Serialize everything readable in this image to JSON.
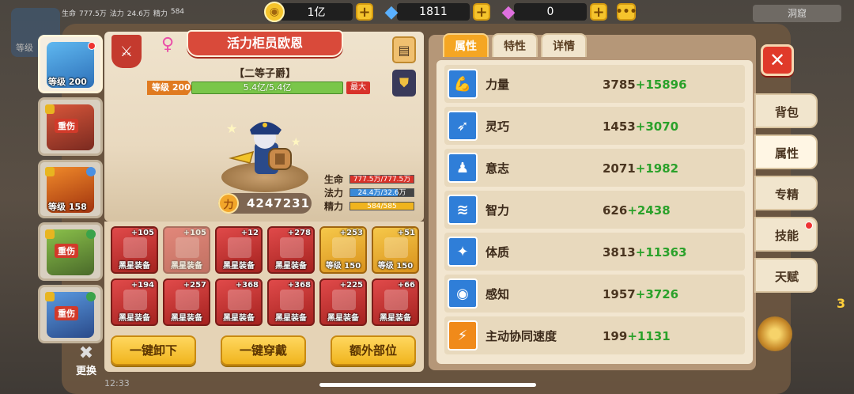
{
  "top": {
    "mini_stats": {
      "hp_label": "生命",
      "hp_value": "777.5万",
      "mp_label": "法力",
      "mp_value": "24.6万",
      "energy_label": "精力",
      "energy_value": "584"
    },
    "mini_avatar_level": "等级",
    "resources": [
      {
        "icon": "coin-icon",
        "value": "1亿"
      },
      {
        "icon": "diamond-icon",
        "value": "1811"
      },
      {
        "icon": "pink-gem-icon",
        "value": "0"
      }
    ],
    "more_label": "•••",
    "right_tag": "洞窟"
  },
  "hero_list": [
    {
      "level": "等级 200",
      "status": "",
      "active": true
    },
    {
      "level": "",
      "status": "重伤",
      "active": false
    },
    {
      "level": "等级 158",
      "status": "",
      "active": false
    },
    {
      "level": "",
      "status": "重伤",
      "active": false
    },
    {
      "level": "",
      "status": "重伤",
      "active": false
    }
  ],
  "change_label": "更换",
  "status_time": "12:33",
  "character": {
    "name": "活力柜员欧恩",
    "title": "【二等子爵】",
    "level_tag": "等级 200",
    "exp": "5.4亿/5.4亿",
    "max_tag": "最大",
    "power": "4247231",
    "vitals": [
      {
        "label": "生命",
        "value": "777.5万/777.5万",
        "fill": 1.0,
        "color": "#d8322a"
      },
      {
        "label": "法力",
        "value": "24.4万/32.6万",
        "fill": 0.75,
        "color": "#3a8ad8"
      },
      {
        "label": "精力",
        "value": "584/585",
        "fill": 0.998,
        "color": "#f0b41e"
      }
    ]
  },
  "equipment": [
    {
      "plus": "+105",
      "label": "黑星装备",
      "style": "red"
    },
    {
      "plus": "+105",
      "label": "黑星装备",
      "style": "faded"
    },
    {
      "plus": "+12",
      "label": "黑星装备",
      "style": "red"
    },
    {
      "plus": "+278",
      "label": "黑星装备",
      "style": "red"
    },
    {
      "plus": "+253",
      "label": "等级 150",
      "style": "gold"
    },
    {
      "plus": "+51",
      "label": "等级 150",
      "style": "gold"
    },
    {
      "plus": "+194",
      "label": "黑星装备",
      "style": "red"
    },
    {
      "plus": "+257",
      "label": "黑星装备",
      "style": "red"
    },
    {
      "plus": "+368",
      "label": "黑星装备",
      "style": "red"
    },
    {
      "plus": "+368",
      "label": "黑星装备",
      "style": "red"
    },
    {
      "plus": "+225",
      "label": "黑星装备",
      "style": "red"
    },
    {
      "plus": "+66",
      "label": "黑星装备",
      "style": "red"
    }
  ],
  "actions": {
    "unequip_all": "一键卸下",
    "equip_all": "一键穿戴",
    "extra_slots": "额外部位"
  },
  "tabs": [
    "属性",
    "特性",
    "详情"
  ],
  "attributes": [
    {
      "name": "力量",
      "base": "3785",
      "bonus": "+15896",
      "icon": "strength-icon"
    },
    {
      "name": "灵巧",
      "base": "1453",
      "bonus": "+3070",
      "icon": "agility-icon"
    },
    {
      "name": "意志",
      "base": "2071",
      "bonus": "+1982",
      "icon": "will-icon"
    },
    {
      "name": "智力",
      "base": "626",
      "bonus": "+2438",
      "icon": "intellect-icon"
    },
    {
      "name": "体质",
      "base": "3813",
      "bonus": "+11363",
      "icon": "constitution-icon"
    },
    {
      "name": "感知",
      "base": "1957",
      "bonus": "+3726",
      "icon": "perception-icon"
    },
    {
      "name": "主动协同速度",
      "base": "199",
      "bonus": "+1131",
      "icon": "speed-icon"
    }
  ],
  "side_tabs": [
    {
      "label": "背包",
      "active": false,
      "dot": false
    },
    {
      "label": "属性",
      "active": true,
      "dot": false
    },
    {
      "label": "专精",
      "active": false,
      "dot": false
    },
    {
      "label": "技能",
      "active": false,
      "dot": true
    },
    {
      "label": "天赋",
      "active": false,
      "dot": false
    }
  ],
  "close_label": "✕",
  "side_number": "3"
}
